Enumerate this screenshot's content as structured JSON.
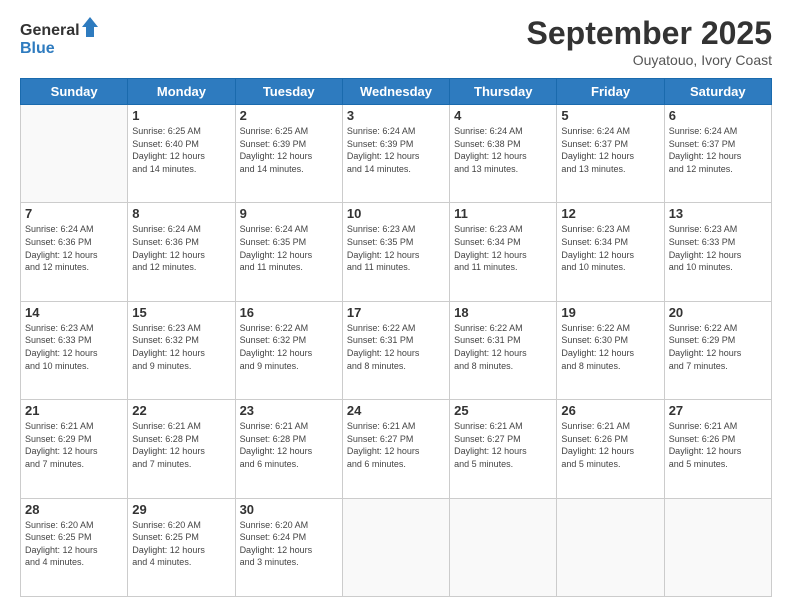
{
  "header": {
    "logo_line1": "General",
    "logo_line2": "Blue",
    "month": "September 2025",
    "location": "Ouyatouo, Ivory Coast"
  },
  "days_of_week": [
    "Sunday",
    "Monday",
    "Tuesday",
    "Wednesday",
    "Thursday",
    "Friday",
    "Saturday"
  ],
  "weeks": [
    [
      {
        "day": "",
        "info": ""
      },
      {
        "day": "1",
        "info": "Sunrise: 6:25 AM\nSunset: 6:40 PM\nDaylight: 12 hours\nand 14 minutes."
      },
      {
        "day": "2",
        "info": "Sunrise: 6:25 AM\nSunset: 6:39 PM\nDaylight: 12 hours\nand 14 minutes."
      },
      {
        "day": "3",
        "info": "Sunrise: 6:24 AM\nSunset: 6:39 PM\nDaylight: 12 hours\nand 14 minutes."
      },
      {
        "day": "4",
        "info": "Sunrise: 6:24 AM\nSunset: 6:38 PM\nDaylight: 12 hours\nand 13 minutes."
      },
      {
        "day": "5",
        "info": "Sunrise: 6:24 AM\nSunset: 6:37 PM\nDaylight: 12 hours\nand 13 minutes."
      },
      {
        "day": "6",
        "info": "Sunrise: 6:24 AM\nSunset: 6:37 PM\nDaylight: 12 hours\nand 12 minutes."
      }
    ],
    [
      {
        "day": "7",
        "info": "Sunrise: 6:24 AM\nSunset: 6:36 PM\nDaylight: 12 hours\nand 12 minutes."
      },
      {
        "day": "8",
        "info": "Sunrise: 6:24 AM\nSunset: 6:36 PM\nDaylight: 12 hours\nand 12 minutes."
      },
      {
        "day": "9",
        "info": "Sunrise: 6:24 AM\nSunset: 6:35 PM\nDaylight: 12 hours\nand 11 minutes."
      },
      {
        "day": "10",
        "info": "Sunrise: 6:23 AM\nSunset: 6:35 PM\nDaylight: 12 hours\nand 11 minutes."
      },
      {
        "day": "11",
        "info": "Sunrise: 6:23 AM\nSunset: 6:34 PM\nDaylight: 12 hours\nand 11 minutes."
      },
      {
        "day": "12",
        "info": "Sunrise: 6:23 AM\nSunset: 6:34 PM\nDaylight: 12 hours\nand 10 minutes."
      },
      {
        "day": "13",
        "info": "Sunrise: 6:23 AM\nSunset: 6:33 PM\nDaylight: 12 hours\nand 10 minutes."
      }
    ],
    [
      {
        "day": "14",
        "info": "Sunrise: 6:23 AM\nSunset: 6:33 PM\nDaylight: 12 hours\nand 10 minutes."
      },
      {
        "day": "15",
        "info": "Sunrise: 6:23 AM\nSunset: 6:32 PM\nDaylight: 12 hours\nand 9 minutes."
      },
      {
        "day": "16",
        "info": "Sunrise: 6:22 AM\nSunset: 6:32 PM\nDaylight: 12 hours\nand 9 minutes."
      },
      {
        "day": "17",
        "info": "Sunrise: 6:22 AM\nSunset: 6:31 PM\nDaylight: 12 hours\nand 8 minutes."
      },
      {
        "day": "18",
        "info": "Sunrise: 6:22 AM\nSunset: 6:31 PM\nDaylight: 12 hours\nand 8 minutes."
      },
      {
        "day": "19",
        "info": "Sunrise: 6:22 AM\nSunset: 6:30 PM\nDaylight: 12 hours\nand 8 minutes."
      },
      {
        "day": "20",
        "info": "Sunrise: 6:22 AM\nSunset: 6:29 PM\nDaylight: 12 hours\nand 7 minutes."
      }
    ],
    [
      {
        "day": "21",
        "info": "Sunrise: 6:21 AM\nSunset: 6:29 PM\nDaylight: 12 hours\nand 7 minutes."
      },
      {
        "day": "22",
        "info": "Sunrise: 6:21 AM\nSunset: 6:28 PM\nDaylight: 12 hours\nand 7 minutes."
      },
      {
        "day": "23",
        "info": "Sunrise: 6:21 AM\nSunset: 6:28 PM\nDaylight: 12 hours\nand 6 minutes."
      },
      {
        "day": "24",
        "info": "Sunrise: 6:21 AM\nSunset: 6:27 PM\nDaylight: 12 hours\nand 6 minutes."
      },
      {
        "day": "25",
        "info": "Sunrise: 6:21 AM\nSunset: 6:27 PM\nDaylight: 12 hours\nand 5 minutes."
      },
      {
        "day": "26",
        "info": "Sunrise: 6:21 AM\nSunset: 6:26 PM\nDaylight: 12 hours\nand 5 minutes."
      },
      {
        "day": "27",
        "info": "Sunrise: 6:21 AM\nSunset: 6:26 PM\nDaylight: 12 hours\nand 5 minutes."
      }
    ],
    [
      {
        "day": "28",
        "info": "Sunrise: 6:20 AM\nSunset: 6:25 PM\nDaylight: 12 hours\nand 4 minutes."
      },
      {
        "day": "29",
        "info": "Sunrise: 6:20 AM\nSunset: 6:25 PM\nDaylight: 12 hours\nand 4 minutes."
      },
      {
        "day": "30",
        "info": "Sunrise: 6:20 AM\nSunset: 6:24 PM\nDaylight: 12 hours\nand 3 minutes."
      },
      {
        "day": "",
        "info": ""
      },
      {
        "day": "",
        "info": ""
      },
      {
        "day": "",
        "info": ""
      },
      {
        "day": "",
        "info": ""
      }
    ]
  ]
}
